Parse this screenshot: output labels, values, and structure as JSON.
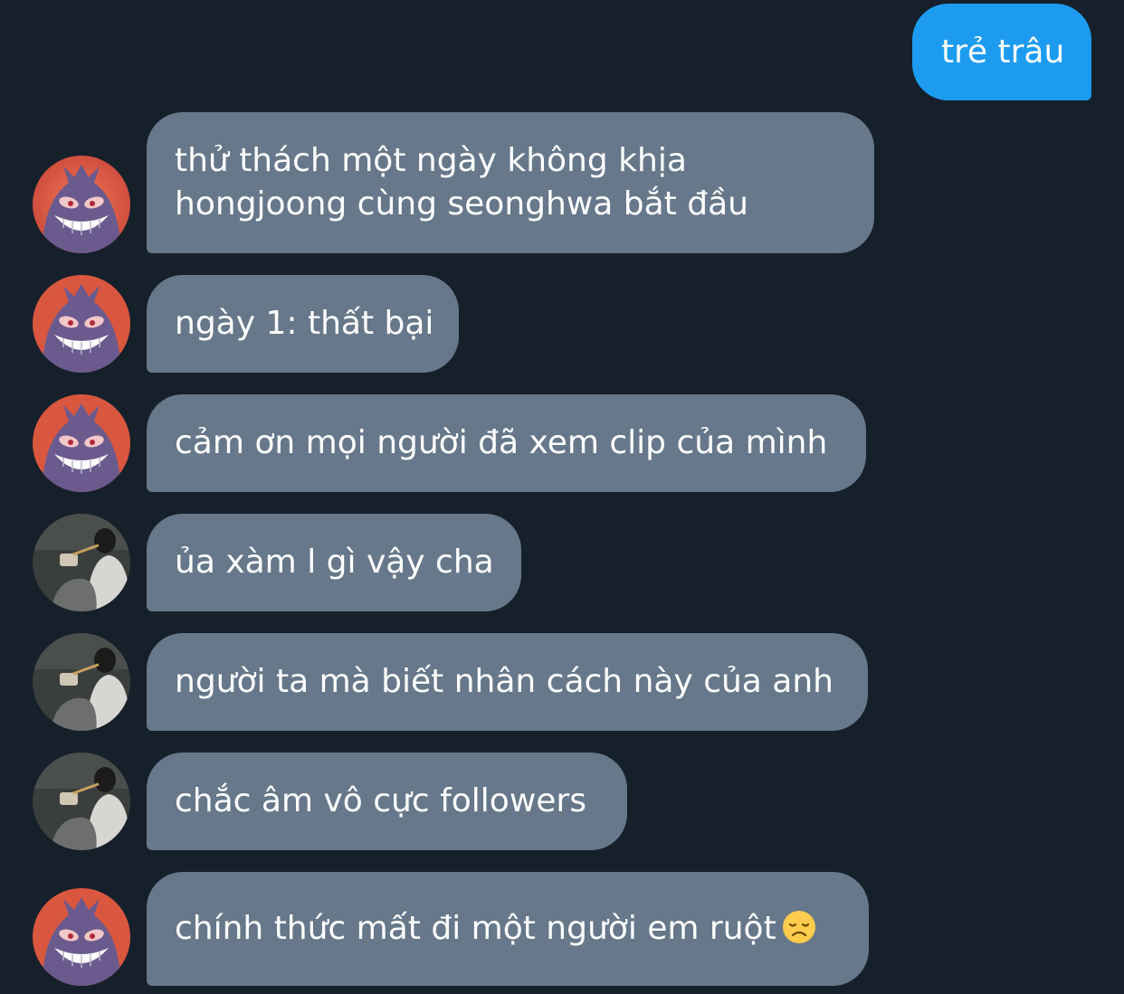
{
  "messages": [
    {
      "id": "m0",
      "direction": "sent",
      "lines": [
        "trẻ trâu"
      ]
    },
    {
      "id": "m1",
      "direction": "received",
      "avatar": "gengar-avatar",
      "lines": [
        "thử thách một ngày không khịa",
        "hongjoong cùng seonghwa bắt đầu"
      ]
    },
    {
      "id": "m2",
      "direction": "received",
      "avatar": "gengar-avatar",
      "lines": [
        "ngày 1: thất bại"
      ]
    },
    {
      "id": "m3",
      "direction": "received",
      "avatar": "gengar-avatar",
      "lines": [
        "cảm ơn mọi người đã xem clip của mình"
      ]
    },
    {
      "id": "m4",
      "direction": "received",
      "avatar": "photo-avatar",
      "lines": [
        "ủa xàm l gì vậy cha"
      ]
    },
    {
      "id": "m5",
      "direction": "received",
      "avatar": "photo-avatar",
      "lines": [
        "người ta mà biết nhân cách này của anh"
      ]
    },
    {
      "id": "m6",
      "direction": "received",
      "avatar": "photo-avatar",
      "lines": [
        "chắc âm vô cực followers"
      ]
    },
    {
      "id": "m7",
      "direction": "received",
      "avatar": "gengar-avatar",
      "lines": [
        "chính thức mất đi một người em ruột"
      ],
      "emoji": "disappointed-face-icon"
    }
  ],
  "colors": {
    "background": "#16202b",
    "sent_bubble": "#1d9bf0",
    "received_bubble": "#66788a",
    "text": "#ffffff"
  }
}
